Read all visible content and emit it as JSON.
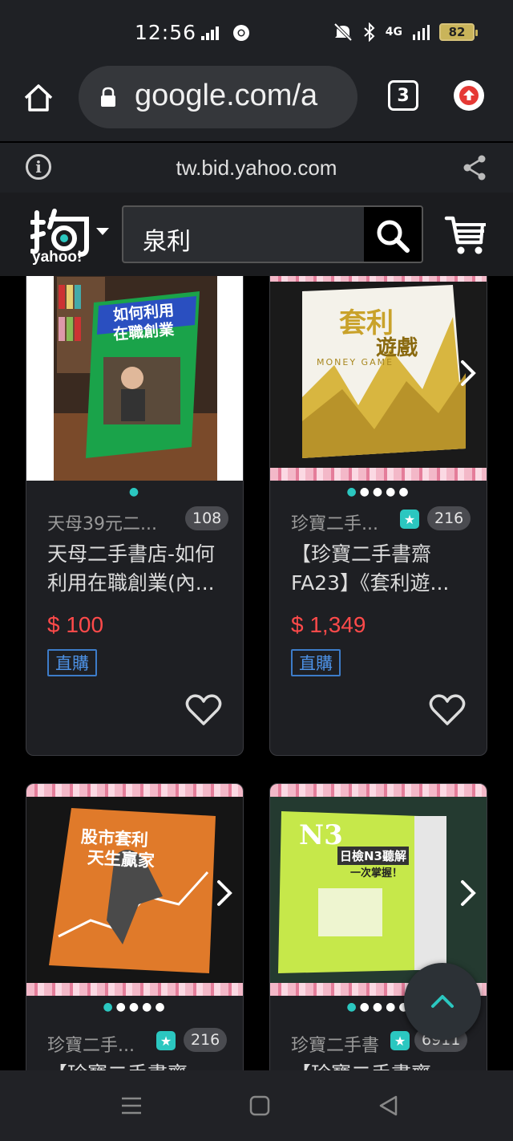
{
  "status_bar": {
    "time": "12:56",
    "network": "4G",
    "battery": "82"
  },
  "browser": {
    "url": "google.com/a",
    "tab_count": "3",
    "domain": "tw.bid.yahoo.com"
  },
  "header": {
    "logo_text": "yahoo!",
    "search_query": "泉利"
  },
  "products": [
    {
      "seller": "天母39元二...",
      "count": "108",
      "title": "天母二手書店-如何利用在職創業(內...",
      "price": "$ 100",
      "tag": "直購",
      "image_text": [
        "如何利用",
        "在職創業"
      ]
    },
    {
      "seller": "珍寶二手...",
      "count": "216",
      "title": "【珍寶二手書齋FA23】《套利遊...",
      "price": "$ 1,349",
      "tag": "直購",
      "image_text": [
        "套利",
        "遊戲",
        "MONEY GAME"
      ]
    },
    {
      "seller": "珍寶二手...",
      "count": "216",
      "title": "【珍寶二手書齋",
      "image_text": [
        "股市套利",
        "天生贏家"
      ]
    },
    {
      "seller": "珍寶二手書",
      "count": "6911",
      "title": "【珍寶二手書齋",
      "image_text": [
        "N3",
        "日檢N3聽解",
        "一次掌握！"
      ]
    }
  ],
  "colors": {
    "price": "#ff4a4a",
    "accent": "#2bc7c0",
    "tag": "#4d92e6"
  }
}
